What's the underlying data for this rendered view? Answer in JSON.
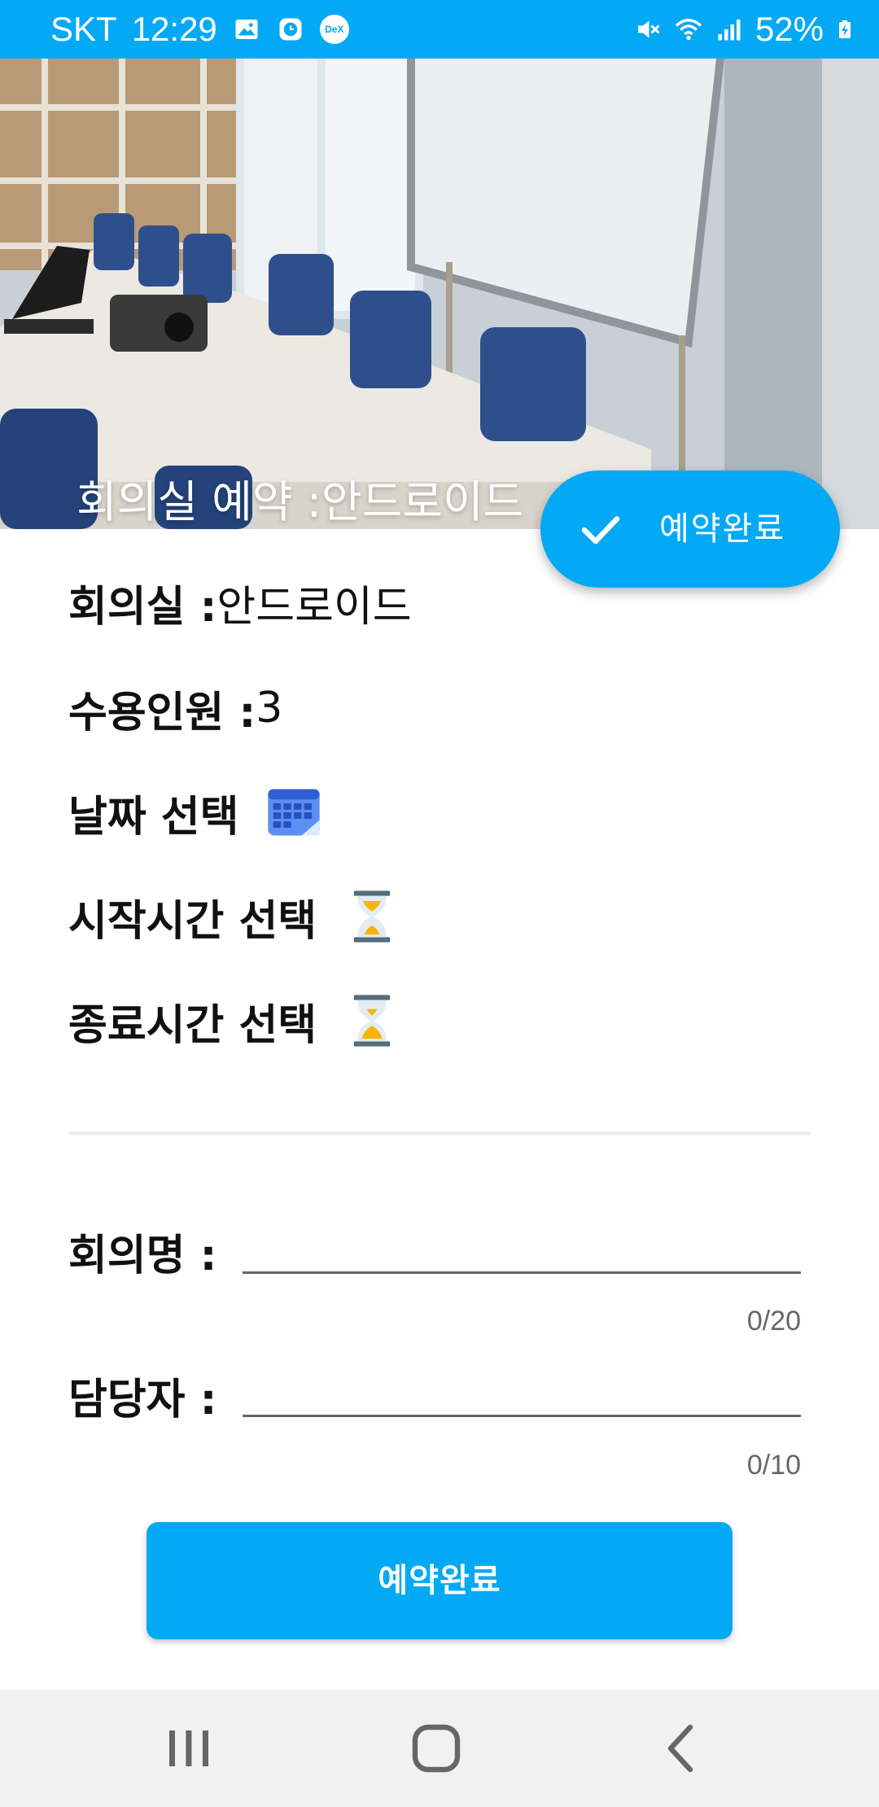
{
  "status_bar": {
    "carrier": "SKT",
    "time": "12:29",
    "notification_icons": [
      "image-icon",
      "clock-app-icon",
      "dex-icon"
    ],
    "dex_label": "DeX",
    "system_icons": [
      "mute-icon",
      "wifi-icon",
      "signal-icon",
      "battery-charging-icon"
    ],
    "battery": "52%",
    "bg_color": "#03A9F4"
  },
  "header": {
    "title": "회의실 예약 :안드로이드"
  },
  "fab": {
    "label": "예약완료",
    "icon": "check-icon"
  },
  "room_info": {
    "room_label": "회의실 : ",
    "room_value": "안드로이드",
    "capacity_label": "수용인원 : ",
    "capacity_value": "3",
    "date_label": "날짜 선택",
    "date_icon": "calendar-icon",
    "start_label": "시작시간 선택",
    "start_icon": "hourglass-icon",
    "end_label": "종료시간 선택",
    "end_icon": "hourglass-icon"
  },
  "form": {
    "meeting_name_label": "회의명 :",
    "meeting_name_value": "",
    "meeting_name_counter": "0/20",
    "owner_label": "담당자 :",
    "owner_value": "",
    "owner_counter": "0/10"
  },
  "submit_button": {
    "label": "예약완료"
  },
  "nav_bar": {
    "icons": [
      "recent-apps-icon",
      "home-icon",
      "back-icon"
    ]
  },
  "colors": {
    "accent": "#03A9F4",
    "nav_bg": "#F1F1F1",
    "divider": "#EEEEEE"
  }
}
